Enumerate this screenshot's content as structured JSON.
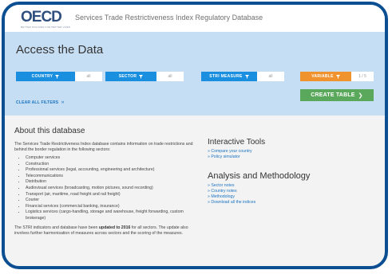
{
  "header": {
    "logo_text": "OECD",
    "logo_tagline": "BETTER POLICIES FOR BETTER LIVES",
    "title": "Services Trade Restrictiveness Index Regulatory Database"
  },
  "access": {
    "title": "Access the Data",
    "filters": [
      {
        "label": "COUNTRY",
        "value": "all",
        "color": "#1a8fe0"
      },
      {
        "label": "SECTOR",
        "value": "all",
        "color": "#1a8fe0"
      },
      {
        "label": "STRI MEASURE",
        "value": "all",
        "color": "#1a8fe0"
      },
      {
        "label": "VARIABLE",
        "value": "1 / 5",
        "color": "#f0922e"
      }
    ],
    "clear_filters": "CLEAR ALL FILTERS",
    "clear_icon": "x-icon",
    "create_table": "CREATE TABLE",
    "create_table_icon": "chevron-right-icon"
  },
  "about": {
    "title": "About this database",
    "description": "The Services Trade Restrictiveness Index database contains information on trade restrictions and behind the border regulation in the following sectors:",
    "sectors": [
      "Computer services",
      "Construction",
      "Professional services (legal, accounting, engineering and architecture)",
      "Telecommunications",
      "Distribution",
      "Audiovisual services (broadcasting, motion pictures, sound recording)",
      "Transport (air, maritime, road freight and rail freight)",
      "Courier",
      "Financial services (commercial banking, insurance)",
      "Logistics services (cargo-handling, storage and warehouse, freight forwarding, custom brokerage)"
    ],
    "note_prefix": "The STRI indicators and database have been",
    "note_bold": "updated to 2016",
    "note_suffix": "for all sectors. The update also involves further harmonisation of measures across sectors and the scoring of the measures."
  },
  "tools": {
    "title": "Interactive Tools",
    "links": [
      "» Compare your country",
      "» Policy simulator"
    ]
  },
  "analysis": {
    "title": "Analysis and Methodology",
    "links": [
      "» Sector notes",
      "» Country notes",
      "» Methodology",
      "» Download all the indices"
    ]
  }
}
